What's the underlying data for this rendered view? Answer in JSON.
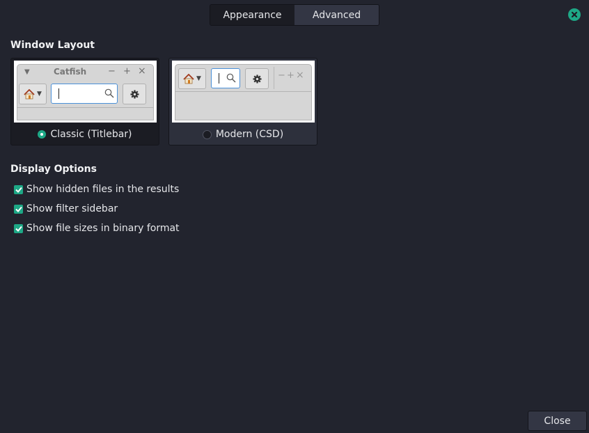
{
  "tabs": [
    {
      "label": "Appearance",
      "active": true
    },
    {
      "label": "Advanced",
      "active": false
    }
  ],
  "window_close_icon": "close-icon",
  "window_layout": {
    "title": "Window Layout",
    "options": [
      {
        "label": "Classic (Titlebar)",
        "selected": true,
        "preview_title": "Catfish"
      },
      {
        "label": "Modern (CSD)",
        "selected": false
      }
    ],
    "preview_controls": {
      "minimize": "−",
      "maximize": "+",
      "close": "×",
      "menu": "▾"
    }
  },
  "display_options": {
    "title": "Display Options",
    "items": [
      {
        "label": "Show hidden files in the results",
        "checked": true
      },
      {
        "label": "Show filter sidebar",
        "checked": true
      },
      {
        "label": "Show file sizes in binary format",
        "checked": true
      }
    ]
  },
  "footer": {
    "close_label": "Close"
  },
  "colors": {
    "accent": "#1ea886",
    "background": "#22242e"
  }
}
